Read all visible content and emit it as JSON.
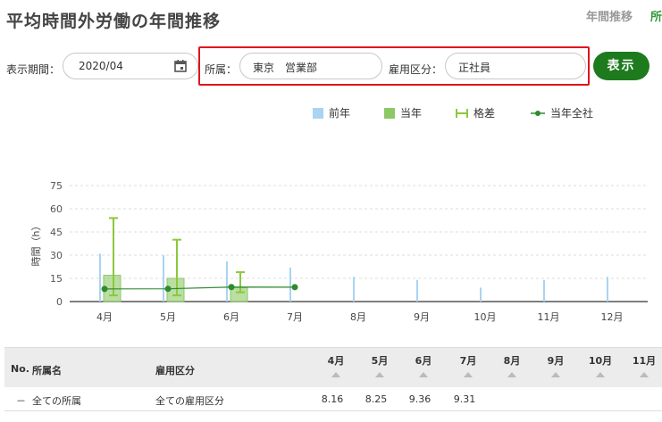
{
  "page": {
    "title": "平均時間外労働の年間推移"
  },
  "tabs": [
    {
      "label": "年間推移"
    },
    {
      "label": "所"
    }
  ],
  "filters": {
    "period_label": "表示期間：",
    "period_value": "2020/04",
    "dept_label": "所属：",
    "dept_value": "東京　営業部",
    "employment_label": "雇用区分：",
    "employment_value": "正社員",
    "show_button": "表示"
  },
  "legend": {
    "prev_year": "前年",
    "this_year": "当年",
    "diff": "格差",
    "company": "当年全社"
  },
  "colors": {
    "prev_year": "#a9d4f2",
    "this_year": "#8cc865",
    "diff": "#8cc83c",
    "company": "#2e8b2e",
    "accent": "#1d7a1d",
    "highlight": "#e0141e"
  },
  "chart_data": {
    "type": "bar",
    "categories": [
      "4月",
      "5月",
      "6月",
      "7月",
      "8月",
      "9月",
      "10月",
      "11月",
      "12月"
    ],
    "ylabel": "時間（h）",
    "ylim": [
      0,
      75
    ],
    "yticks": [
      0,
      15,
      30,
      45,
      60,
      75
    ],
    "grid": true,
    "legend_position": "top-right",
    "series": [
      {
        "name": "前年",
        "type": "bar",
        "values": [
          31,
          30,
          26,
          22,
          16,
          14,
          9,
          14,
          16
        ]
      },
      {
        "name": "当年",
        "type": "bar",
        "values": [
          17,
          15,
          9,
          null,
          null,
          null,
          null,
          null,
          null
        ]
      },
      {
        "name": "格差",
        "type": "errorbar",
        "low": [
          4,
          4,
          6,
          null,
          null,
          null,
          null,
          null,
          null
        ],
        "high": [
          54,
          40,
          19,
          null,
          null,
          null,
          null,
          null,
          null
        ]
      },
      {
        "name": "当年全社",
        "type": "line",
        "values": [
          8.16,
          8.25,
          9.36,
          9.31,
          null,
          null,
          null,
          null,
          null
        ]
      }
    ]
  },
  "table": {
    "headers": {
      "no": "No.",
      "dept": "所属名",
      "employment": "雇用区分"
    },
    "months": [
      "4月",
      "5月",
      "6月",
      "7月",
      "8月",
      "9月",
      "10月",
      "11月"
    ],
    "rows": [
      {
        "no": "－",
        "dept": "全ての所属",
        "employment": "全ての雇用区分",
        "values": [
          "8.16",
          "8.25",
          "9.36",
          "9.31",
          "",
          "",
          "",
          ""
        ]
      }
    ]
  }
}
